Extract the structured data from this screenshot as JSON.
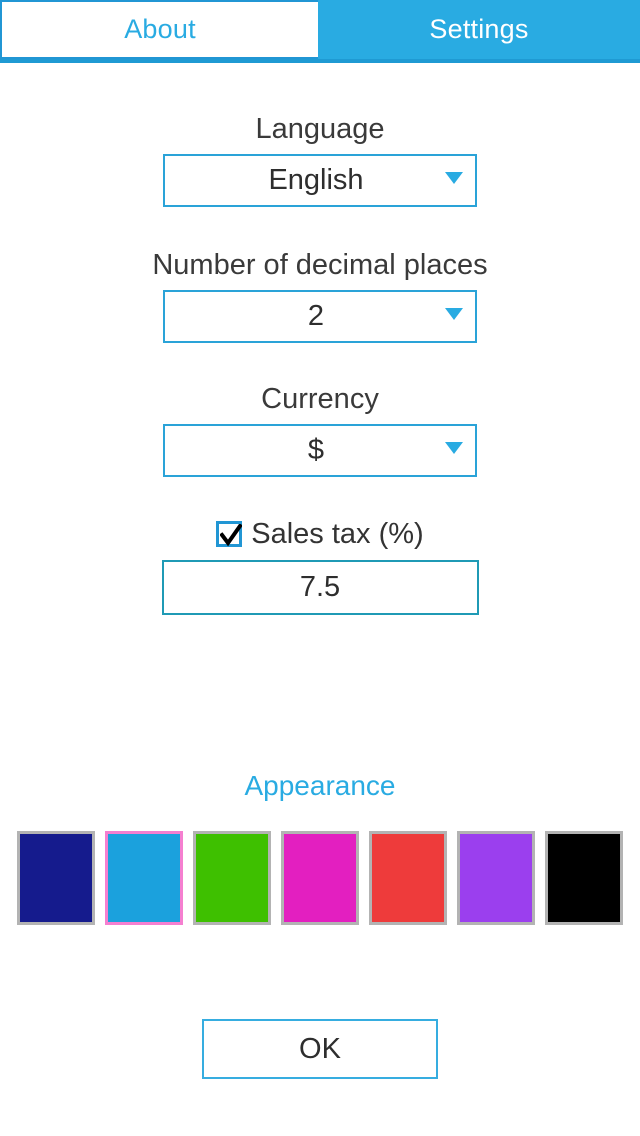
{
  "theme": {
    "accent": "#29abe2",
    "border_blue": "#2aa3d8",
    "label_gray": "#3a3a3a",
    "selected_swatch_border": "#f57fd0",
    "swatch_border": "#b3b3b3"
  },
  "tabs": [
    {
      "label": "About",
      "active": false,
      "style": "light"
    },
    {
      "label": "Settings",
      "active": true,
      "style": "accent"
    }
  ],
  "settings": {
    "language": {
      "label": "Language",
      "value": "English",
      "arrow_icon": "chevron-down-icon",
      "options": [
        "English"
      ]
    },
    "decimals": {
      "label": "Number of decimal places",
      "value": "2",
      "arrow_icon": "chevron-down-icon",
      "options": [
        "2"
      ]
    },
    "currency": {
      "label": "Currency",
      "value": "$",
      "arrow_icon": "chevron-down-icon",
      "options": [
        "$"
      ]
    },
    "sales_tax": {
      "label": "Sales tax (%)",
      "checked": true,
      "check_icon": "checkmark-icon",
      "value": "7.5",
      "placeholder": "7.5"
    }
  },
  "appearance": {
    "title": "Appearance",
    "swatches": [
      {
        "name": "navy",
        "color": "#151b8d",
        "selected": false
      },
      {
        "name": "light-blue",
        "color": "#1ba1dd",
        "selected": true
      },
      {
        "name": "green",
        "color": "#3ec000",
        "selected": false
      },
      {
        "name": "magenta",
        "color": "#e31fc0",
        "selected": false
      },
      {
        "name": "red",
        "color": "#ee3b3b",
        "selected": false
      },
      {
        "name": "purple",
        "color": "#9b3fee",
        "selected": false
      },
      {
        "name": "black",
        "color": "#000000",
        "selected": false
      }
    ]
  },
  "footer": {
    "ok_label": "OK"
  }
}
